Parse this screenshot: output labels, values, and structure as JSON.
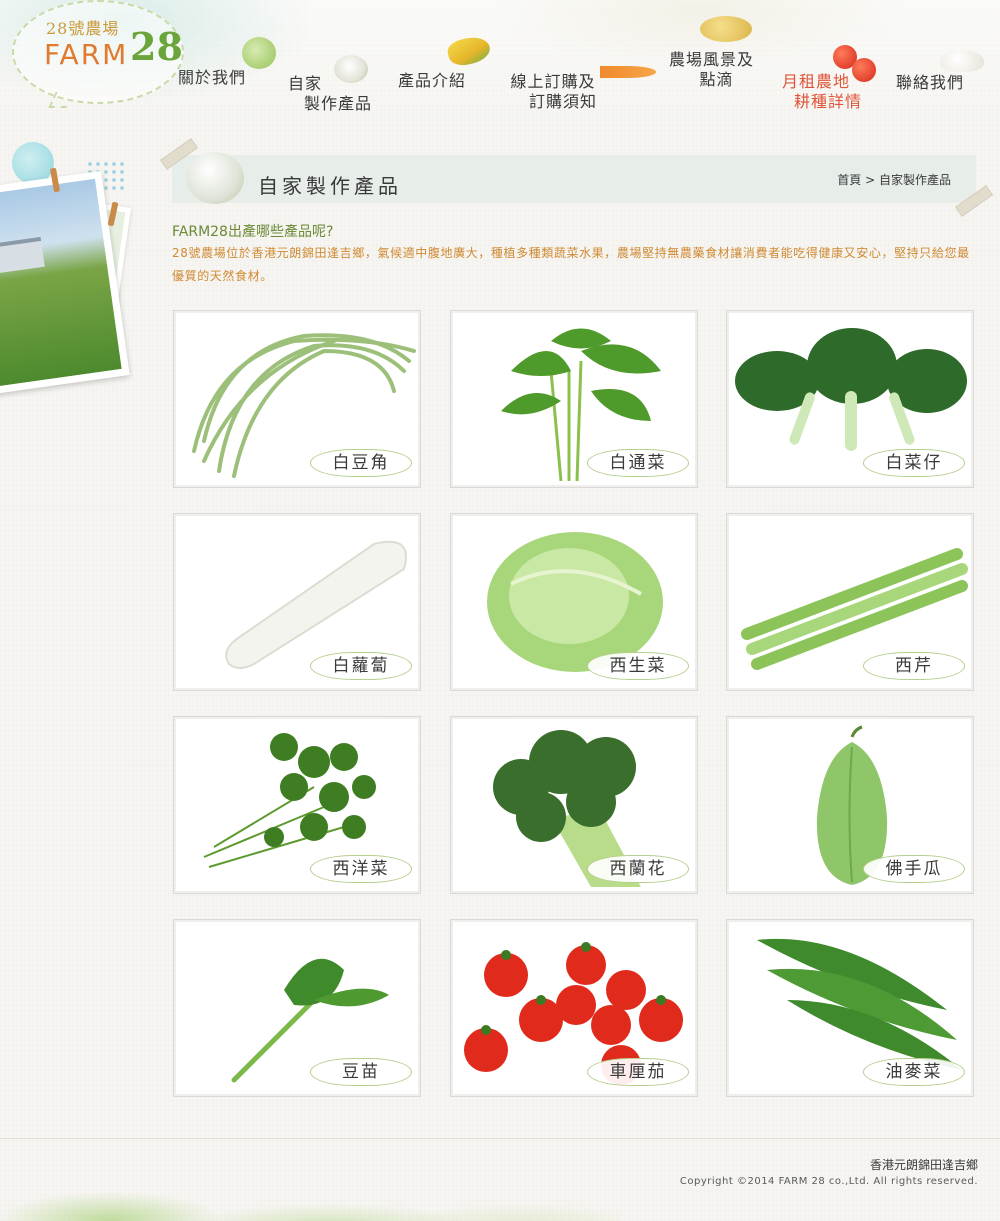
{
  "logo": {
    "sub": "28號農場",
    "main": "FARM",
    "num": "28"
  },
  "nav": [
    {
      "label": "關於我們"
    },
    {
      "line1": "自家",
      "line2": "製作產品"
    },
    {
      "label": "產品介紹"
    },
    {
      "line1": "線上訂購及",
      "line2": "訂購須知"
    },
    {
      "line1": "農場風景及",
      "line2": "點滴"
    },
    {
      "line1": "月租農地",
      "line2": "耕種詳情"
    },
    {
      "label": "聯絡我們"
    }
  ],
  "section": {
    "title": "自家製作產品",
    "breadcrumb_home": "首頁",
    "breadcrumb_sep": " > ",
    "breadcrumb_current": "自家製作產品"
  },
  "intro": {
    "question": "FARM28出產哪些產品呢?",
    "body": "28號農場位於香港元朗錦田逢吉鄉，氣候適中腹地廣大，種植多種類蔬菜水果，農場堅持無農藥食材讓消費者能吃得健康又安心，堅持只給您最優質的天然食材。"
  },
  "products": [
    {
      "name": "白豆角",
      "icon": "yardlong-bean"
    },
    {
      "name": "白通菜",
      "icon": "water-spinach"
    },
    {
      "name": "白菜仔",
      "icon": "bok-choy"
    },
    {
      "name": "白蘿蔔",
      "icon": "daikon"
    },
    {
      "name": "西生菜",
      "icon": "lettuce"
    },
    {
      "name": "西芹",
      "icon": "celery"
    },
    {
      "name": "西洋菜",
      "icon": "watercress"
    },
    {
      "name": "西蘭花",
      "icon": "broccoli"
    },
    {
      "name": "佛手瓜",
      "icon": "chayote"
    },
    {
      "name": "豆苗",
      "icon": "pea-shoot"
    },
    {
      "name": "車厘茄",
      "icon": "cherry-tomato"
    },
    {
      "name": "油麥菜",
      "icon": "a-choy"
    }
  ],
  "footer": {
    "address": "香港元朗錦田逢吉鄉",
    "copyright": "Copyright ©2014 FARM 28 co.,Ltd. All rights reserved."
  },
  "colors": {
    "accent_green": "#6ba43a",
    "accent_orange": "#d08a33",
    "active_red": "#e0553a"
  }
}
